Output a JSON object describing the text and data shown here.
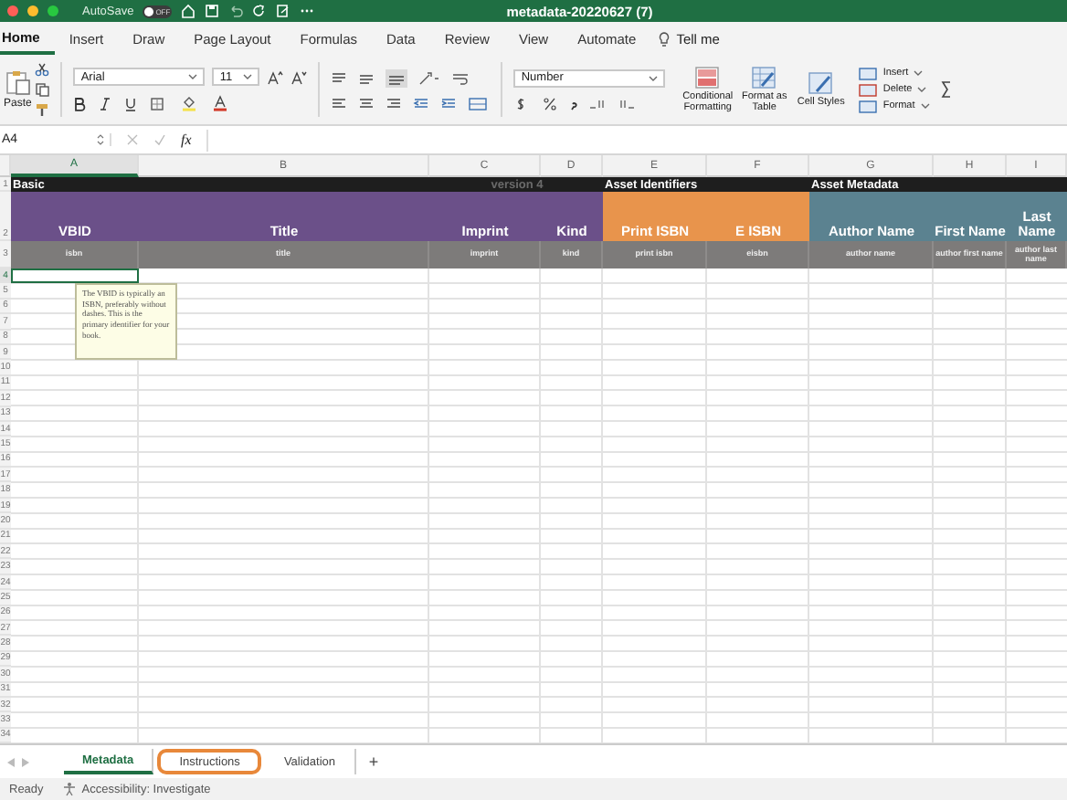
{
  "window": {
    "title": "metadata-20220627 (7)",
    "autosave": {
      "label": "AutoSave",
      "state_text": "OFF",
      "on": false
    }
  },
  "ribbon_tabs": [
    {
      "label": "Home",
      "selected": true
    },
    {
      "label": "Insert",
      "selected": false
    },
    {
      "label": "Draw",
      "selected": false
    },
    {
      "label": "Page Layout",
      "selected": false
    },
    {
      "label": "Formulas",
      "selected": false
    },
    {
      "label": "Data",
      "selected": false
    },
    {
      "label": "Review",
      "selected": false
    },
    {
      "label": "View",
      "selected": false
    },
    {
      "label": "Automate",
      "selected": false
    }
  ],
  "tell_me": "Tell me",
  "ribbon": {
    "paste": "Paste",
    "font": "Arial",
    "font_size": "11",
    "number_format": "Number",
    "style_buttons": [
      {
        "kind": "conditional",
        "label": "Conditional Formatting"
      },
      {
        "kind": "table",
        "label": "Format as Table"
      },
      {
        "kind": "styles",
        "label": "Cell Styles"
      }
    ],
    "cell_buttons": [
      "Insert",
      "Delete",
      "Format"
    ]
  },
  "formula_bar": {
    "name_box": "A4",
    "fx": "fx"
  },
  "columns": [
    {
      "letter": "A",
      "selected": true
    },
    {
      "letter": "B",
      "selected": false
    },
    {
      "letter": "C",
      "selected": false
    },
    {
      "letter": "D",
      "selected": false
    },
    {
      "letter": "E",
      "selected": false
    },
    {
      "letter": "F",
      "selected": false
    },
    {
      "letter": "G",
      "selected": false
    },
    {
      "letter": "H",
      "selected": false
    },
    {
      "letter": "I",
      "selected": false
    }
  ],
  "group_row": {
    "row": "1"
  },
  "header_row": {
    "row": "2",
    "groups": [
      {
        "text": "Basic",
        "faint": false,
        "cells": [
          {
            "text": "VBID",
            "color": "#6b5089"
          },
          {
            "text": "Title",
            "color": "#6b5089"
          }
        ]
      },
      {
        "text": "version 4",
        "faint": true,
        "cells": [
          {
            "text": "Imprint",
            "color": "#6b5089"
          },
          {
            "text": "Kind",
            "color": "#6b5089"
          }
        ]
      },
      {
        "text": "Asset Identifiers",
        "faint": false,
        "cells": [
          {
            "text": "Print ISBN",
            "color": "#e8944c"
          },
          {
            "text": "E ISBN",
            "color": "#e8944c"
          }
        ]
      },
      {
        "text": "Asset Metadata",
        "faint": false,
        "cells": [
          {
            "text": "Author Name",
            "color": "#5b8290"
          },
          {
            "text": "First Name",
            "color": "#5b8290"
          },
          {
            "text": "Last Name",
            "color": "#5b8290"
          }
        ]
      }
    ]
  },
  "field_row": {
    "row": "3",
    "cells": [
      "isbn",
      "title",
      "imprint",
      "kind",
      "print isbn",
      "eisbn",
      "author name",
      "author first name",
      "author last name"
    ]
  },
  "rows": [
    {
      "number": "4",
      "selected": true
    },
    {
      "number": "5",
      "selected": false
    },
    {
      "number": "6",
      "selected": false
    },
    {
      "number": "7",
      "selected": false
    },
    {
      "number": "8",
      "selected": false
    },
    {
      "number": "9",
      "selected": false
    },
    {
      "number": "10",
      "selected": false
    },
    {
      "number": "11",
      "selected": false
    },
    {
      "number": "12",
      "selected": false
    },
    {
      "number": "13",
      "selected": false
    },
    {
      "number": "14",
      "selected": false
    },
    {
      "number": "15",
      "selected": false
    },
    {
      "number": "16",
      "selected": false
    },
    {
      "number": "17",
      "selected": false
    },
    {
      "number": "18",
      "selected": false
    },
    {
      "number": "19",
      "selected": false
    },
    {
      "number": "20",
      "selected": false
    },
    {
      "number": "21",
      "selected": false
    },
    {
      "number": "22",
      "selected": false
    },
    {
      "number": "23",
      "selected": false
    },
    {
      "number": "24",
      "selected": false
    },
    {
      "number": "25",
      "selected": false
    },
    {
      "number": "26",
      "selected": false
    },
    {
      "number": "27",
      "selected": false
    },
    {
      "number": "28",
      "selected": false
    },
    {
      "number": "29",
      "selected": false
    },
    {
      "number": "30",
      "selected": false
    },
    {
      "number": "31",
      "selected": false
    },
    {
      "number": "32",
      "selected": false
    },
    {
      "number": "33",
      "selected": false
    },
    {
      "number": "34",
      "selected": false
    }
  ],
  "comment": "The VBID is typically an ISBN, preferably without dashes. This is the primary identifier for your book.",
  "sheet_tabs": [
    {
      "label": "Metadata",
      "selected": true,
      "highlighted": false
    },
    {
      "label": "Instructions",
      "selected": false,
      "highlighted": true
    },
    {
      "label": "Validation",
      "selected": false,
      "highlighted": false
    }
  ],
  "add_sheet": "+",
  "status_bar": {
    "ready": "Ready",
    "accessibility": "Accessibility: Investigate"
  }
}
